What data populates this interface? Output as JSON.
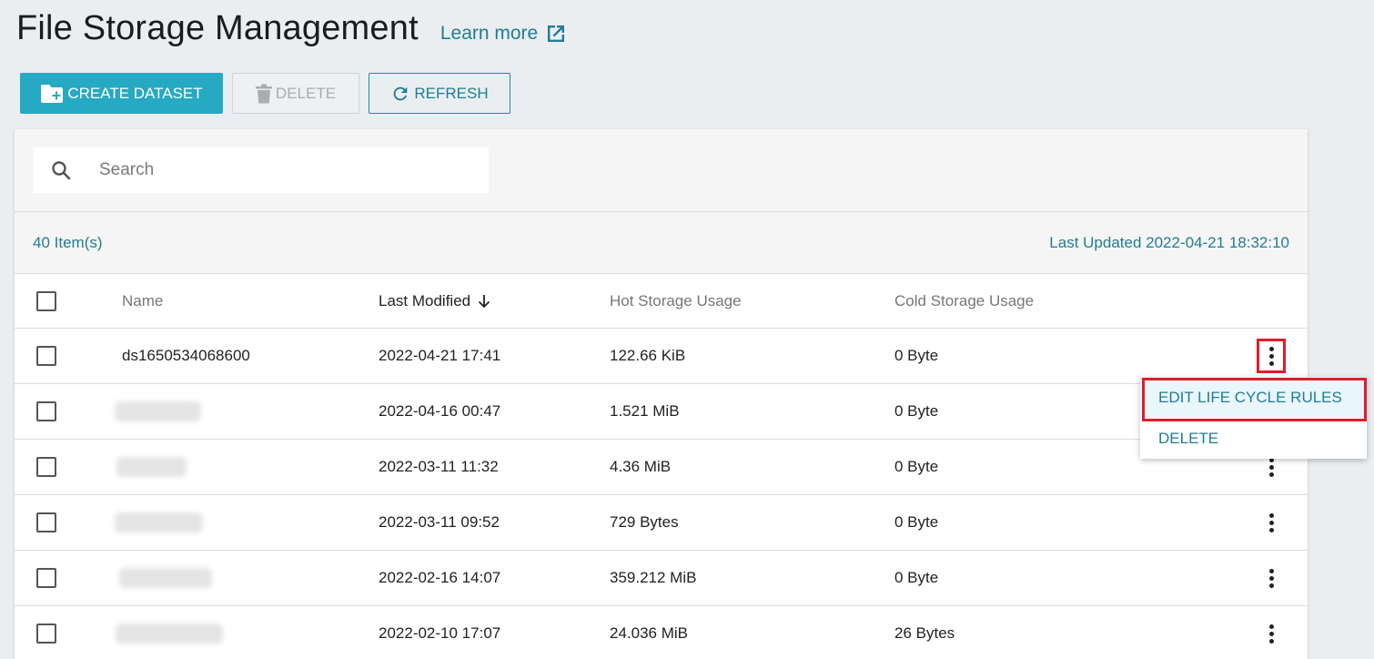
{
  "header": {
    "title": "File Storage Management",
    "learn_more": "Learn more"
  },
  "toolbar": {
    "create_label": "CREATE DATASET",
    "delete_label": "DELETE",
    "refresh_label": "REFRESH"
  },
  "search": {
    "placeholder": "Search"
  },
  "info": {
    "item_count": "40 Item(s)",
    "last_updated": "Last Updated 2022-04-21 18:32:10"
  },
  "table": {
    "columns": {
      "name": "Name",
      "last_modified": "Last Modified",
      "hot": "Hot Storage Usage",
      "cold": "Cold Storage Usage"
    },
    "rows": [
      {
        "name": "ds1650534068600",
        "modified": "2022-04-21 17:41",
        "hot": "122.66 KiB",
        "cold": "0 Byte"
      },
      {
        "name": "",
        "modified": "2022-04-16 00:47",
        "hot": "1.521 MiB",
        "cold": "0 Byte"
      },
      {
        "name": "",
        "modified": "2022-03-11 11:32",
        "hot": "4.36 MiB",
        "cold": "0 Byte"
      },
      {
        "name": "",
        "modified": "2022-03-11 09:52",
        "hot": "729 Bytes",
        "cold": "0 Byte"
      },
      {
        "name": "",
        "modified": "2022-02-16 14:07",
        "hot": "359.212 MiB",
        "cold": "0 Byte"
      },
      {
        "name": "",
        "modified": "2022-02-10 17:07",
        "hot": "24.036 MiB",
        "cold": "26 Bytes"
      }
    ]
  },
  "context_menu": {
    "edit_label": "EDIT LIFE CYCLE RULES",
    "delete_label": "DELETE"
  },
  "colors": {
    "accent": "#26a9c2",
    "link": "#1f7d95",
    "highlight": "#e21c2a"
  }
}
